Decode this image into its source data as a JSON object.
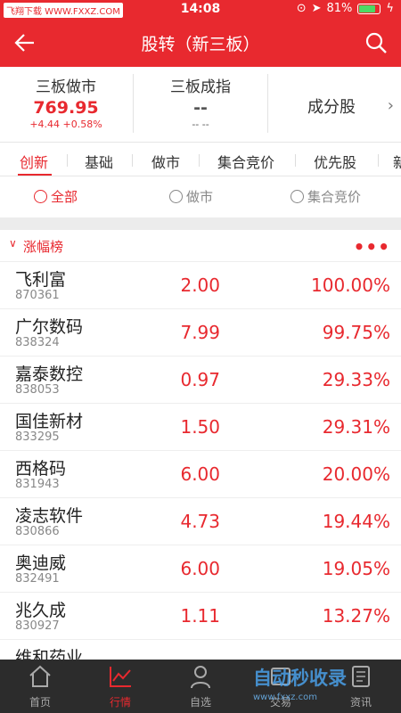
{
  "status_bar": {
    "badge": "飞翔下载 WWW.FXXZ.COM",
    "time": "14:08",
    "battery": "81%"
  },
  "header": {
    "title": "股转（新三板）"
  },
  "indices": {
    "market_maker": {
      "name": "三板做市",
      "value": "769.95",
      "change": "+4.44  +0.58%"
    },
    "component": {
      "name": "三板成指",
      "value": "--",
      "change": "--  --"
    },
    "constituents": {
      "label": "成分股"
    }
  },
  "tabs": [
    "创新",
    "基础",
    "做市",
    "集合竞价",
    "优先股",
    "新"
  ],
  "filters": {
    "all": "全部",
    "market_making": "做市",
    "auction": "集合竞价"
  },
  "list_header": {
    "label": "涨幅榜",
    "more": "•••"
  },
  "rows": [
    {
      "name": "飞利富",
      "code": "870361",
      "price": "2.00",
      "pct": "100.00%"
    },
    {
      "name": "广尔数码",
      "code": "838324",
      "price": "7.99",
      "pct": "99.75%"
    },
    {
      "name": "嘉泰数控",
      "code": "838053",
      "price": "0.97",
      "pct": "29.33%"
    },
    {
      "name": "国佳新材",
      "code": "833295",
      "price": "1.50",
      "pct": "29.31%"
    },
    {
      "name": "西格码",
      "code": "831943",
      "price": "6.00",
      "pct": "20.00%"
    },
    {
      "name": "凌志软件",
      "code": "830866",
      "price": "4.73",
      "pct": "19.44%"
    },
    {
      "name": "奥迪威",
      "code": "832491",
      "price": "6.00",
      "pct": "19.05%"
    },
    {
      "name": "兆久成",
      "code": "830927",
      "price": "1.11",
      "pct": "13.27%"
    },
    {
      "name": "维和药业",
      "code": "",
      "price": "",
      "pct": ""
    }
  ],
  "bottom_nav": {
    "home": "首页",
    "market": "行情",
    "watchlist": "自选",
    "trade": "交易",
    "news": "资讯"
  },
  "watermark": {
    "text": "自动秒收录",
    "url": "www.fxxz.com"
  },
  "colors": {
    "brand_red": "#e8292f",
    "bottom_bar": "#2c2c2c"
  }
}
